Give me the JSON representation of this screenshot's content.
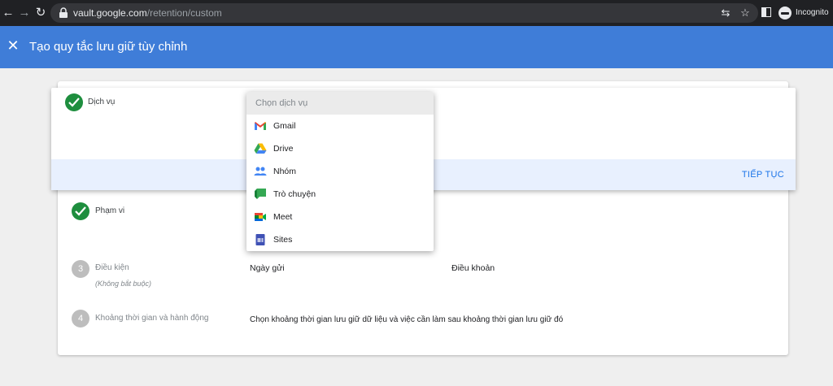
{
  "browser": {
    "url_host": "vault.google.com",
    "url_path": "/retention/custom",
    "profile_label": "Incognito"
  },
  "appbar": {
    "title": "Tạo quy tắc lưu giữ tùy chỉnh",
    "color": "#3f7dd8"
  },
  "steps": [
    {
      "label": "Dịch vụ",
      "status": "done"
    },
    {
      "label": "Phạm vi",
      "status": "done"
    },
    {
      "label": "Điều kiện",
      "number": "3",
      "sublabel": "(Không bắt buộc)"
    },
    {
      "label": "Khoảng thời gian và hành động",
      "number": "4"
    }
  ],
  "active_step": {
    "continue_label": "TIẾP TỤC"
  },
  "conditions": {
    "sent_date": "Ngày gửi",
    "terms": "Điều khoản"
  },
  "duration": {
    "description": "Chọn khoảng thời gian lưu giữ dữ liệu và việc cần làm sau khoảng thời gian lưu giữ đó"
  },
  "service_dropdown": {
    "placeholder": "Chọn dịch vụ",
    "options": [
      {
        "label": "Gmail",
        "icon": "gmail-icon"
      },
      {
        "label": "Drive",
        "icon": "drive-icon"
      },
      {
        "label": "Nhóm",
        "icon": "groups-icon"
      },
      {
        "label": "Trò chuyện",
        "icon": "chat-icon"
      },
      {
        "label": "Meet",
        "icon": "meet-icon"
      },
      {
        "label": "Sites",
        "icon": "sites-icon"
      }
    ]
  }
}
